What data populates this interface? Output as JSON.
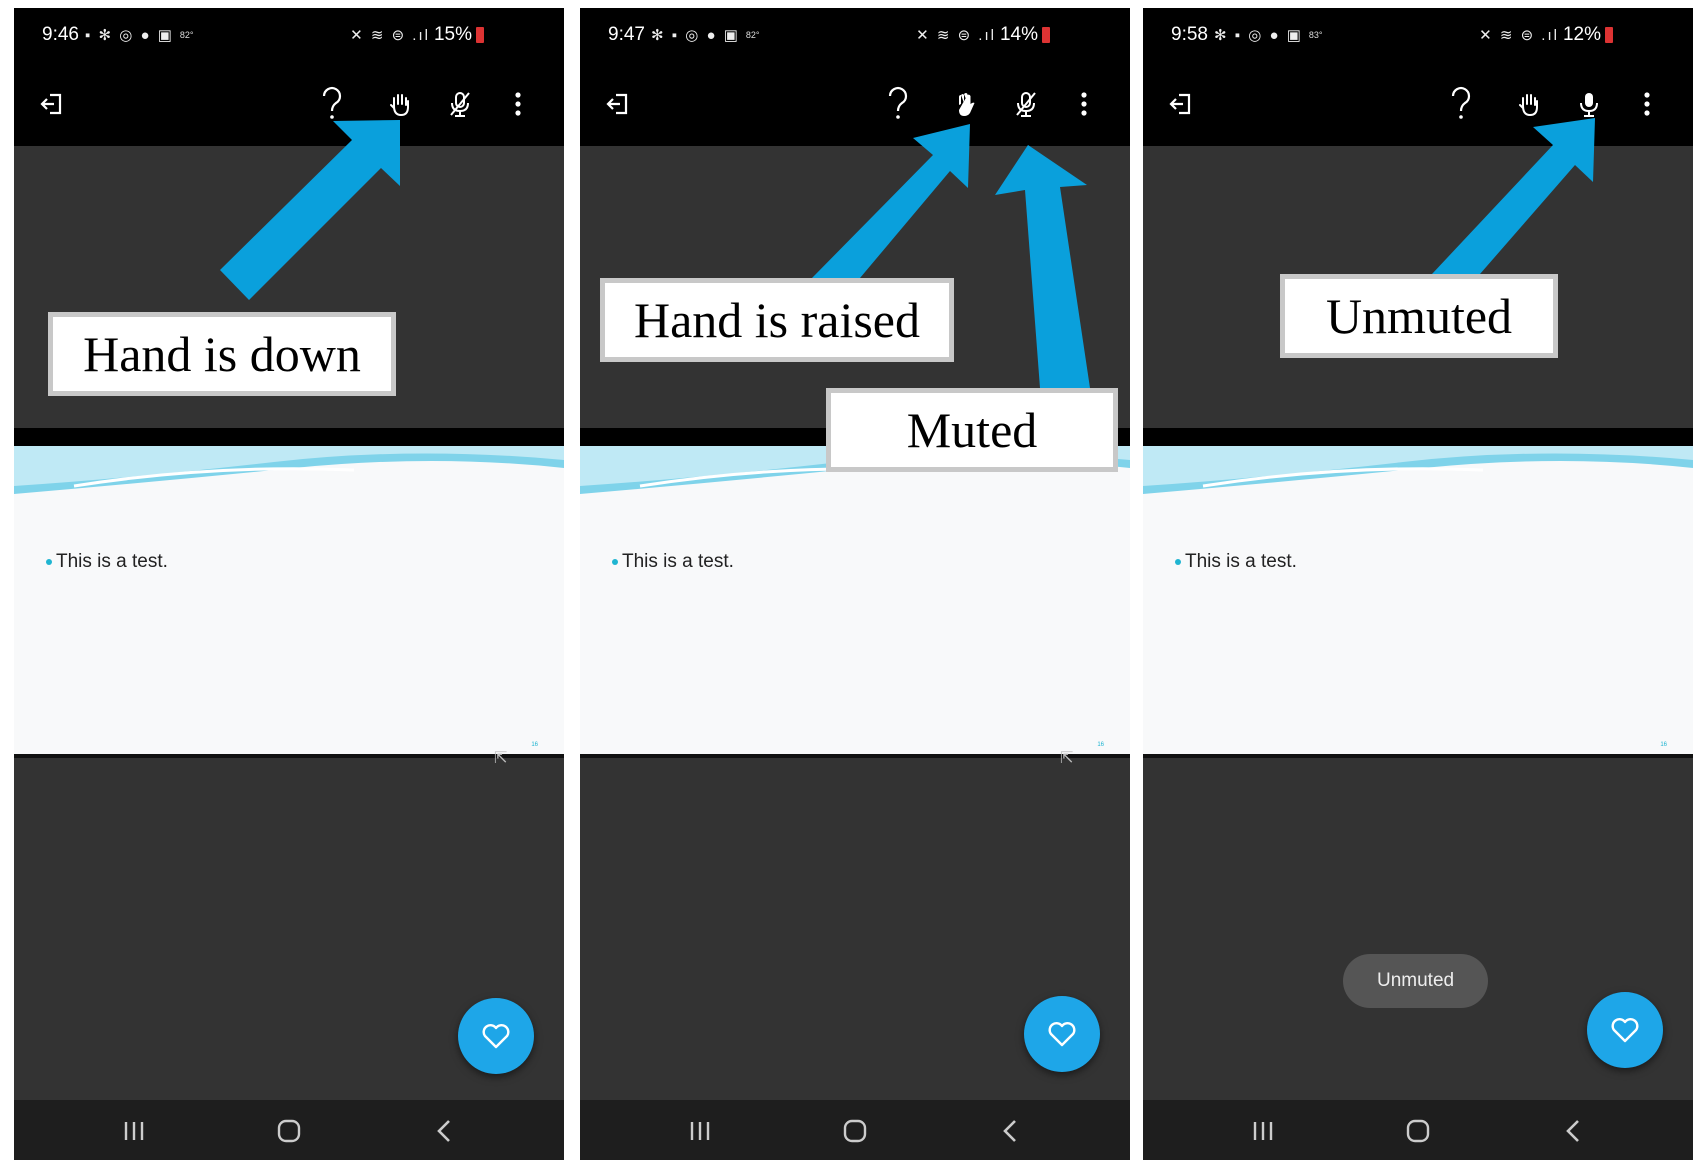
{
  "colors": {
    "accent": "#1ea6e8",
    "arrow": "#0aa0dc",
    "bullet": "#1fb5d1",
    "background": "#333333",
    "bar": "#000000"
  },
  "panels": [
    {
      "status": {
        "time": "9:46",
        "notif": "▪ ✻ ◎ ● ▣",
        "temp": "82°",
        "signal": "✕ ≋ ⊜ .ıl",
        "battery": "15%"
      },
      "slide_text": "This is a test.",
      "slide_page": "16",
      "callouts": [
        "Hand is down"
      ],
      "hand_state": "down",
      "mic_state": "muted",
      "toast": ""
    },
    {
      "status": {
        "time": "9:47",
        "notif": "✻ ▪ ◎ ● ▣",
        "temp": "82°",
        "signal": "✕ ≋ ⊜ .ıl",
        "battery": "14%"
      },
      "slide_text": "This is a test.",
      "slide_page": "16",
      "callouts": [
        "Hand is raised",
        "Muted"
      ],
      "hand_state": "raised",
      "mic_state": "muted",
      "toast": ""
    },
    {
      "status": {
        "time": "9:58",
        "notif": "✻ ▪ ◎ ● ▣",
        "temp": "83°",
        "signal": "✕ ≋ ⊜ .ıl",
        "battery": "12%"
      },
      "slide_text": "This is a test.",
      "slide_page": "16",
      "callouts": [
        "Unmuted"
      ],
      "hand_state": "down",
      "mic_state": "unmuted",
      "toast": "Unmuted"
    }
  ],
  "icons": {
    "exit": "exit-icon",
    "help": "help-icon",
    "hand": "raise-hand-icon",
    "mic_muted": "mic-muted-icon",
    "mic": "mic-icon",
    "more": "more-vertical-icon",
    "fab": "heart-icon",
    "recents": "recents-icon",
    "home": "home-icon",
    "back": "back-icon"
  }
}
